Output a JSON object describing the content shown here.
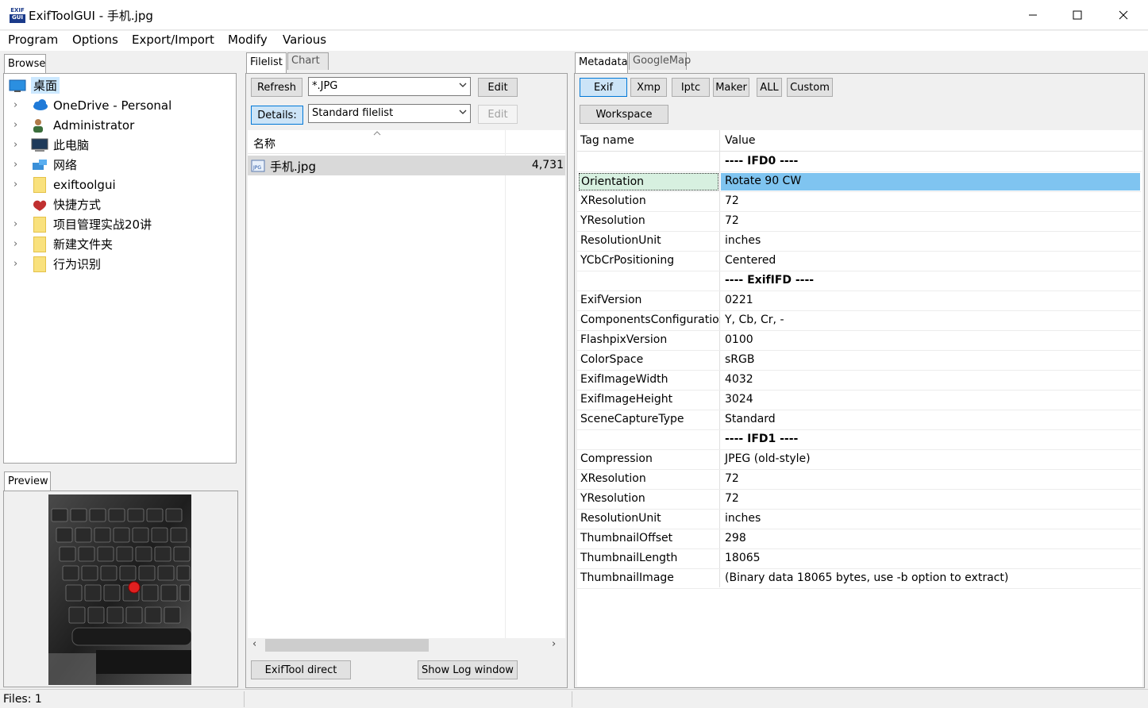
{
  "window": {
    "title": "ExifToolGUI - 手机.jpg",
    "icon_text_top": "EXIF",
    "icon_text_bottom": "GUI"
  },
  "menu": [
    "Program",
    "Options",
    "Export/Import",
    "Modify",
    "Various"
  ],
  "browse": {
    "tab": "Browse",
    "items": [
      {
        "label": "桌面",
        "icon": "desktop-icon",
        "expandable": false,
        "selected": true
      },
      {
        "label": "OneDrive - Personal",
        "icon": "cloud-icon",
        "expandable": true
      },
      {
        "label": "Administrator",
        "icon": "user-icon",
        "expandable": true
      },
      {
        "label": "此电脑",
        "icon": "computer-icon",
        "expandable": true
      },
      {
        "label": "网络",
        "icon": "network-icon",
        "expandable": true
      },
      {
        "label": "exiftoolgui",
        "icon": "folder-icon",
        "expandable": true
      },
      {
        "label": "快捷方式",
        "icon": "shortcut-icon",
        "expandable": false
      },
      {
        "label": "项目管理实战20讲",
        "icon": "folder-icon",
        "expandable": true
      },
      {
        "label": "新建文件夹",
        "icon": "folder-icon",
        "expandable": true
      },
      {
        "label": "行为识别",
        "icon": "folder-icon",
        "expandable": true
      }
    ]
  },
  "preview": {
    "tab": "Preview"
  },
  "filelist": {
    "tabs": [
      "Filelist",
      "Chart"
    ],
    "refresh": "Refresh",
    "filter_value": "*.JPG",
    "edit": "Edit",
    "details": "Details:",
    "view_value": "Standard filelist",
    "edit2": "Edit",
    "col_name": "名称",
    "files": [
      {
        "name": "手机.jpg",
        "size": "4,731"
      }
    ],
    "exiftool_direct": "ExifTool direct",
    "show_log": "Show Log window"
  },
  "metadata": {
    "tabs": [
      "Metadata",
      "GoogleMap"
    ],
    "buttons": [
      "Exif",
      "Xmp",
      "Iptc",
      "Maker",
      "ALL",
      "Custom"
    ],
    "workspace": "Workspace",
    "col_tag": "Tag name",
    "col_value": "Value",
    "rows": [
      {
        "k": "",
        "v": "---- IFD0 ----",
        "hdr": true
      },
      {
        "k": "Orientation",
        "v": "Rotate 90 CW",
        "sel": true
      },
      {
        "k": "XResolution",
        "v": "72"
      },
      {
        "k": "YResolution",
        "v": "72"
      },
      {
        "k": "ResolutionUnit",
        "v": "inches"
      },
      {
        "k": "YCbCrPositioning",
        "v": "Centered"
      },
      {
        "k": "",
        "v": "---- ExifIFD ----",
        "hdr": true
      },
      {
        "k": "ExifVersion",
        "v": "0221"
      },
      {
        "k": "ComponentsConfiguration",
        "v": "Y, Cb, Cr, -"
      },
      {
        "k": "FlashpixVersion",
        "v": "0100"
      },
      {
        "k": "ColorSpace",
        "v": "sRGB"
      },
      {
        "k": "ExifImageWidth",
        "v": "4032"
      },
      {
        "k": "ExifImageHeight",
        "v": "3024"
      },
      {
        "k": "SceneCaptureType",
        "v": "Standard"
      },
      {
        "k": "",
        "v": "---- IFD1 ----",
        "hdr": true
      },
      {
        "k": "Compression",
        "v": "JPEG (old-style)"
      },
      {
        "k": "XResolution",
        "v": "72"
      },
      {
        "k": "YResolution",
        "v": "72"
      },
      {
        "k": "ResolutionUnit",
        "v": "inches"
      },
      {
        "k": "ThumbnailOffset",
        "v": "298"
      },
      {
        "k": "ThumbnailLength",
        "v": "18065"
      },
      {
        "k": "ThumbnailImage",
        "v": "(Binary data 18065 bytes, use -b option to extract)"
      }
    ]
  },
  "status": {
    "files": "Files: 1"
  },
  "colors": {
    "selection": "#7fc4f0",
    "accent": "#0078d7"
  }
}
